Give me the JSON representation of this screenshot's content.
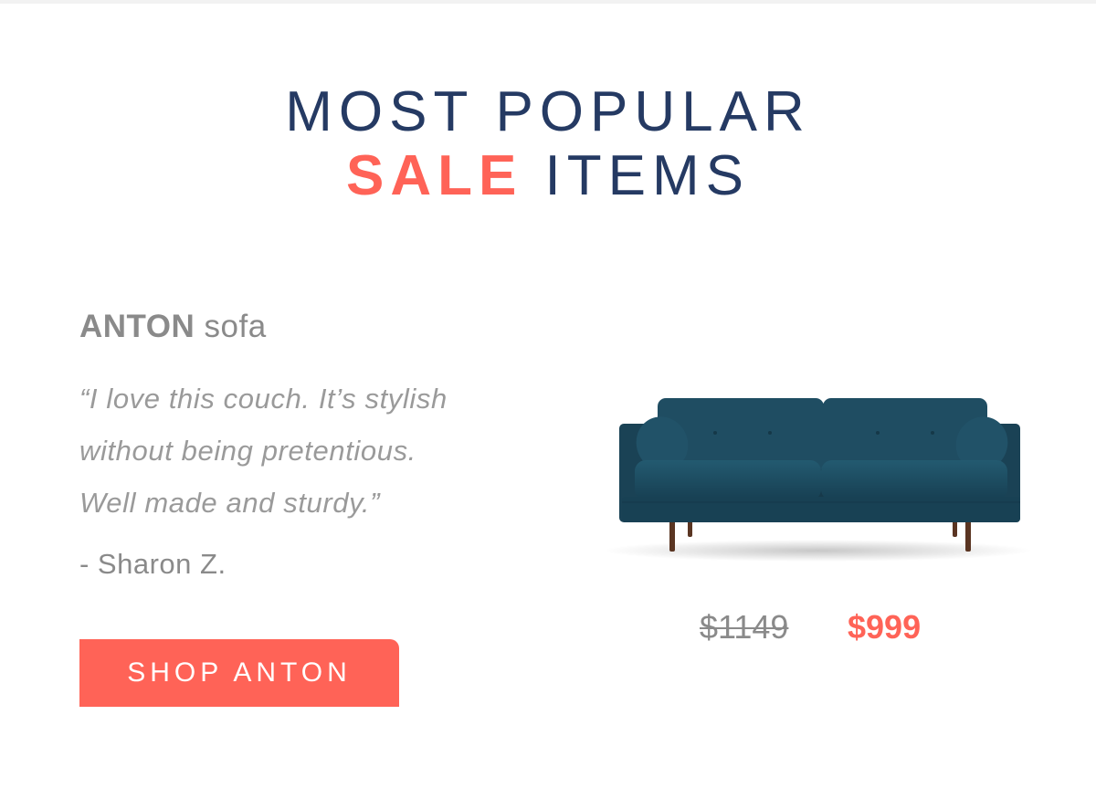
{
  "headline": {
    "line1": "MOST POPULAR",
    "accent": "SALE",
    "rest": " ITEMS"
  },
  "product": {
    "name_bold": "ANTON",
    "name_rest": " sofa",
    "quote_lines": [
      "“I love this couch. It’s stylish",
      "without being pretentious.",
      "Well made and sturdy.”"
    ],
    "author": "- Sharon Z.",
    "cta_label": "SHOP ANTON",
    "price_original": "$1149",
    "price_sale": "$999",
    "image_icon": "sofa-image"
  },
  "colors": {
    "navy": "#253a63",
    "accent": "#ff6357",
    "gray_text": "#8a8a8a",
    "sofa": "#1d4a5e"
  }
}
